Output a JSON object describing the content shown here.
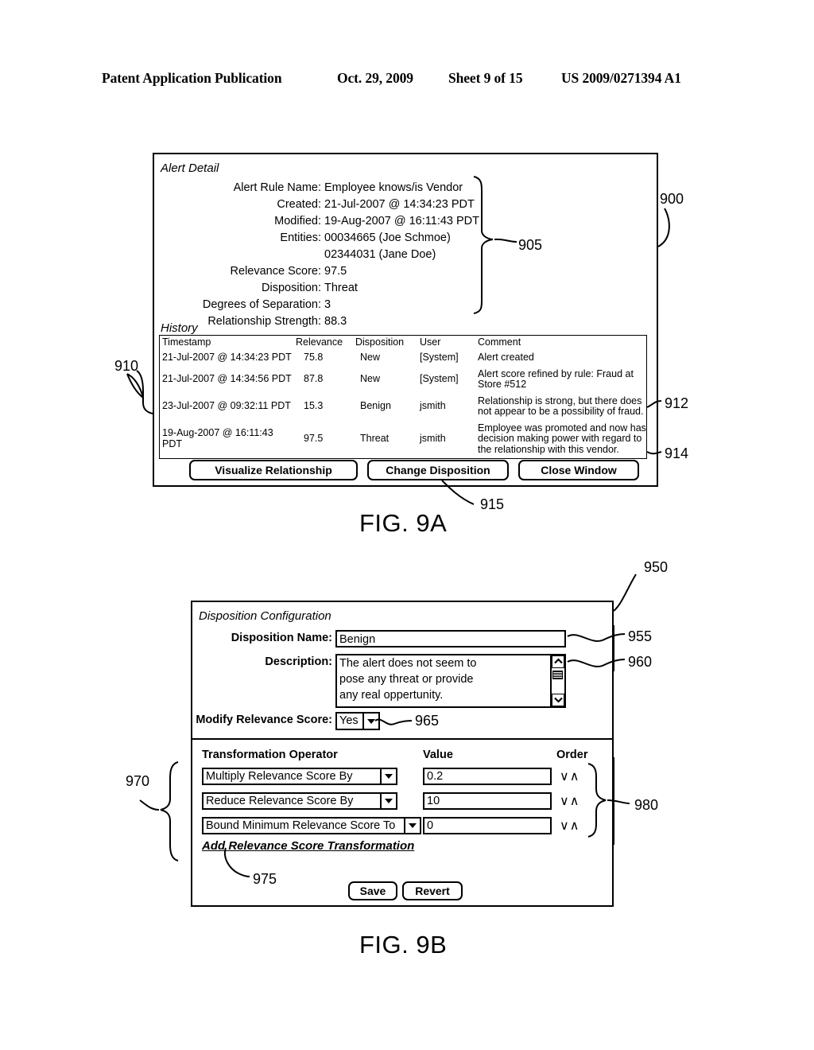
{
  "header": {
    "publication": "Patent Application Publication",
    "date": "Oct. 29, 2009",
    "sheet": "Sheet 9 of 15",
    "patent_number": "US 2009/0271394 A1"
  },
  "fig9a": {
    "figure_label": "FIG. 9A",
    "alert_detail": {
      "section_title": "Alert Detail",
      "fields": [
        {
          "label": "Alert Rule Name:",
          "value": "Employee knows/is Vendor"
        },
        {
          "label": "Created:",
          "value": "21-Jul-2007 @ 14:34:23 PDT"
        },
        {
          "label": "Modified:",
          "value": "19-Aug-2007 @ 16:11:43 PDT"
        },
        {
          "label": "Entities:",
          "value": "00034665 (Joe Schmoe)"
        },
        {
          "label": "",
          "value": "02344031 (Jane Doe)"
        },
        {
          "label": "Relevance Score:",
          "value": "97.5"
        },
        {
          "label": "Disposition:",
          "value": "Threat"
        },
        {
          "label": "Degrees of Separation:",
          "value": "3"
        },
        {
          "label": "Relationship Strength:",
          "value": "88.3"
        }
      ]
    },
    "history": {
      "section_title": "History",
      "columns": [
        "Timestamp",
        "Relevance",
        "Disposition",
        "User",
        "Comment"
      ],
      "rows": [
        {
          "timestamp": "21-Jul-2007 @ 14:34:23 PDT",
          "relevance": "75.8",
          "disposition": "New",
          "user": "[System]",
          "comment": "Alert created"
        },
        {
          "timestamp": "21-Jul-2007 @ 14:34:56 PDT",
          "relevance": "87.8",
          "disposition": "New",
          "user": "[System]",
          "comment": "Alert score refined by rule: Fraud at Store #512"
        },
        {
          "timestamp": "23-Jul-2007 @ 09:32:11 PDT",
          "relevance": "15.3",
          "disposition": "Benign",
          "user": "jsmith",
          "comment": "Relationship is strong, but there does not appear to be a possibility of fraud."
        },
        {
          "timestamp": "19-Aug-2007 @ 16:11:43 PDT",
          "relevance": "97.5",
          "disposition": "Threat",
          "user": "jsmith",
          "comment": "Employee was promoted and now has decision making power with regard to the relationship with this vendor."
        }
      ]
    },
    "buttons": {
      "visualize": "Visualize Relationship",
      "change_disposition": "Change Disposition",
      "close_window": "Close Window"
    },
    "callouts": {
      "window": "900",
      "detail_brace": "905",
      "history_brace": "910",
      "row_benign": "912",
      "row_threat": "914",
      "button_bar": "915"
    }
  },
  "fig9b": {
    "figure_label": "FIG. 9B",
    "section_title": "Disposition Configuration",
    "disposition_name": {
      "label": "Disposition Name:",
      "value": "Benign"
    },
    "description": {
      "label": "Description:",
      "value": "The alert does not seem to\npose any threat or provide\nany real oppertunity."
    },
    "modify_relevance": {
      "label": "Modify Relevance Score:",
      "value": "Yes"
    },
    "transformations": {
      "columns": [
        "Transformation Operator",
        "Value",
        "Order"
      ],
      "rows": [
        {
          "operator": "Multiply Relevance Score By",
          "value": "0.2",
          "order": "∨∧"
        },
        {
          "operator": "Reduce Relevance Score By",
          "value": "10",
          "order": "∨∧"
        },
        {
          "operator": "Bound Minimum Relevance Score To",
          "value": "0",
          "order": "∨∧"
        }
      ]
    },
    "add_link": "Add Relevance Score Transformation",
    "buttons": {
      "save": "Save",
      "revert": "Revert"
    },
    "callouts": {
      "window": "950",
      "name_field": "955",
      "description_field": "960",
      "modify_select": "965",
      "operator_brace": "970",
      "add_link": "975",
      "order_brace": "980"
    }
  }
}
